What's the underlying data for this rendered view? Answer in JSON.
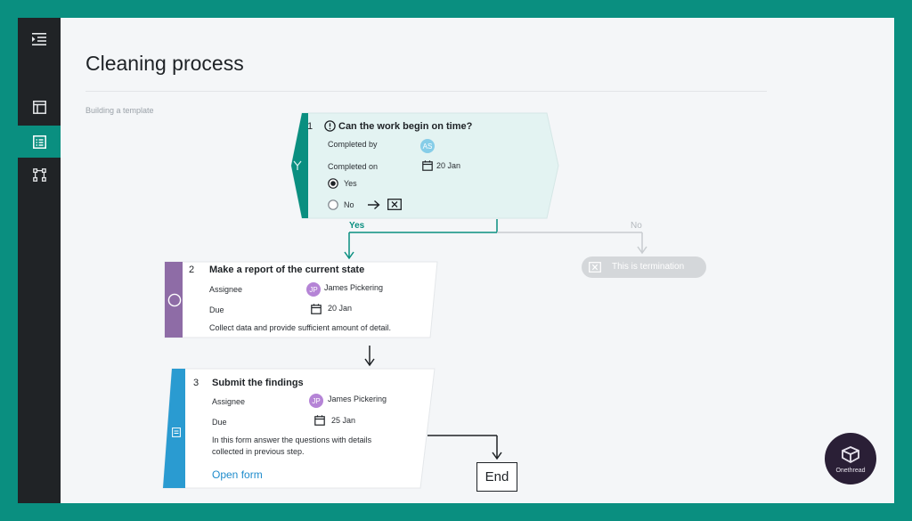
{
  "page": {
    "title": "Cleaning process",
    "breadcrumb": "Building a template"
  },
  "sidebar": {
    "items": [
      {
        "icon": "menu-collapse-icon"
      },
      {
        "icon": "layout-icon"
      },
      {
        "icon": "checklist-icon",
        "active": true
      },
      {
        "icon": "workflow-icon"
      }
    ]
  },
  "colors": {
    "brand": "#0a8f80",
    "decision": "#e3f3f2",
    "purple": "#8e6ca6",
    "blue": "#2a9bd1",
    "grey": "#d4d7da"
  },
  "steps": [
    {
      "number": "1",
      "title": "Can the work begin on time?",
      "completed_by_label": "Completed by",
      "avatar": "AS",
      "completed_on_label": "Completed on",
      "date": "20 Jan",
      "option_yes": "Yes",
      "option_no": "No",
      "selected": "Yes"
    },
    {
      "number": "2",
      "title": "Make a report of the current state",
      "assignee_label": "Assignee",
      "avatar": "JP",
      "assignee": "James Pickering",
      "due_label": "Due",
      "date": "20 Jan",
      "description": "Collect data and provide sufficient amount of detail."
    },
    {
      "number": "3",
      "title": "Submit the findings",
      "assignee_label": "Assignee",
      "avatar": "JP",
      "assignee": "James Pickering",
      "due_label": "Due",
      "date": "25 Jan",
      "description_line1": "In this form answer the questions with details",
      "description_line2": "collected in previous step.",
      "link": "Open form"
    }
  ],
  "branches": {
    "yes": "Yes",
    "no": "No"
  },
  "termination": "This is termination",
  "end": "End",
  "brand": {
    "logo_text": "Onethread"
  }
}
